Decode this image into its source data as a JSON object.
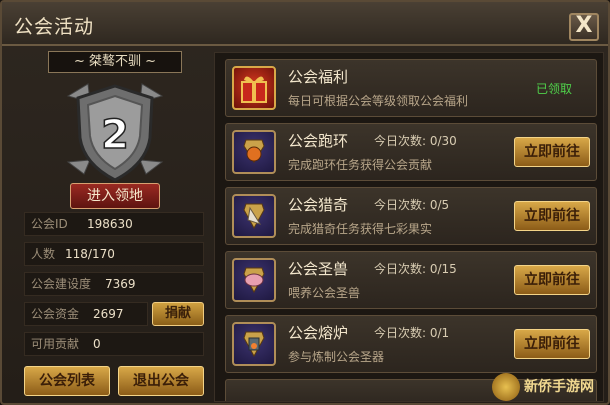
{
  "window": {
    "title": "公会活动",
    "close_label": "X"
  },
  "guild": {
    "name": "~ 桀骜不驯 ~",
    "level": "2",
    "enter_label": "进入领地",
    "info": [
      {
        "label": "公会ID",
        "value": "198630"
      },
      {
        "label": "人数",
        "value": "118/170"
      },
      {
        "label": "公会建设度",
        "value": "7369"
      },
      {
        "label": "公会资金",
        "value": "2697"
      },
      {
        "label": "可用贡献",
        "value": "0"
      }
    ],
    "donate_label": "捐献",
    "list_label": "公会列表",
    "exit_label": "退出公会"
  },
  "activities": [
    {
      "name": "公会福利",
      "count": "",
      "desc": "每日可根据公会等级领取公会福利",
      "status": "已领取",
      "button": "",
      "icon": "gift-box-icon"
    },
    {
      "name": "公会跑环",
      "count": "今日次数: 0/30",
      "desc": "完成跑环任务获得公会贡献",
      "status": "",
      "button": "立即前往",
      "icon": "loop-quest-icon"
    },
    {
      "name": "公会猎奇",
      "count": "今日次数: 0/5",
      "desc": "完成猎奇任务获得七彩果实",
      "status": "",
      "button": "立即前往",
      "icon": "hunt-quest-icon"
    },
    {
      "name": "公会圣兽",
      "count": "今日次数: 0/15",
      "desc": "喂养公会圣兽",
      "status": "",
      "button": "立即前往",
      "icon": "holy-beast-icon"
    },
    {
      "name": "公会熔炉",
      "count": "今日次数: 0/1",
      "desc": "参与炼制公会圣器",
      "status": "",
      "button": "立即前往",
      "icon": "furnace-icon"
    }
  ],
  "watermark": {
    "text": "新侨手游网"
  },
  "colors": {
    "accent_gold": "#d8a848",
    "status_green": "#4fd04a",
    "enter_red": "#9a2a22"
  }
}
